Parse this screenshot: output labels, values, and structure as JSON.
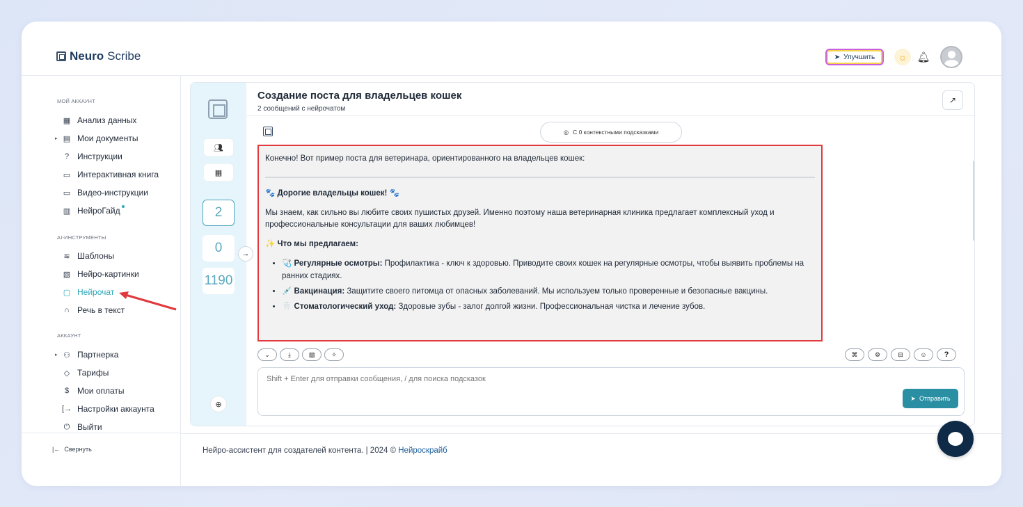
{
  "header": {
    "logo_bold": "Neuro",
    "logo_rest": "Scribe",
    "upgrade_label": "Улучшить",
    "upgrade_icon": "rocket-icon",
    "theme_icon": "sun-icon",
    "notify_icon": "bell-icon"
  },
  "sidebar": {
    "sections": [
      {
        "title": "Мой аккаунт",
        "items": [
          {
            "label": "Анализ данных",
            "icon": "grid-icon",
            "caret": false
          },
          {
            "label": "Мои документы",
            "icon": "document-icon",
            "caret": true
          },
          {
            "label": "Инструкции",
            "icon": "help-icon",
            "caret": false
          },
          {
            "label": "Интерактивная книга",
            "icon": "book-icon",
            "caret": false
          },
          {
            "label": "Видео-инструкции",
            "icon": "video-icon",
            "caret": false
          },
          {
            "label": "НейроГайд",
            "icon": "table-icon",
            "caret": false
          }
        ]
      },
      {
        "title": "AI-инструменты",
        "items": [
          {
            "label": "Шаблоны",
            "icon": "layers-icon"
          },
          {
            "label": "Нейро-картинки",
            "icon": "image-icon"
          },
          {
            "label": "Нейрочат",
            "icon": "chat-icon",
            "active": true
          },
          {
            "label": "Речь в текст",
            "icon": "headphones-icon"
          }
        ]
      },
      {
        "title": "Аккаунт",
        "items": [
          {
            "label": "Партнерка",
            "icon": "users-icon",
            "caret": true
          },
          {
            "label": "Тарифы",
            "icon": "tag-icon"
          },
          {
            "label": "Мои оплаты",
            "icon": "dollar-icon"
          },
          {
            "label": "Настройки аккаунта",
            "icon": "settings-icon"
          },
          {
            "label": "Выйти",
            "icon": "power-icon"
          }
        ]
      }
    ],
    "collapse_label": "Свернуть"
  },
  "chat": {
    "title": "Создание поста для владельцев кошек",
    "subtitle": "2 сообщений с нейрочатом",
    "rail_counts": [
      "2",
      "0",
      "1190"
    ],
    "hint_label": "С 0 контекстными подсказками",
    "message": {
      "intro": "Конечно! Вот пример поста для ветеринара, ориентированного на владельцев кошек:",
      "heading": "Дорогие владельцы кошек!",
      "heading_emoji": "🐾",
      "paragraph": "Мы знаем, как сильно вы любите своих пушистых друзей. Именно поэтому наша ветеринарная клиника предлагает комплексный уход и профессиональные консультации для ваших любимцев!",
      "offer_heading": "Что мы предлагаем:",
      "offer_emoji": "✨",
      "items": [
        {
          "emoji": "🩺",
          "bold": "Регулярные осмотры:",
          "text": " Профилактика - ключ к здоровью. Приводите своих кошек на регулярные осмотры, чтобы выявить проблемы на ранних стадиях."
        },
        {
          "emoji": "💉",
          "bold": "Вакцинация:",
          "text": " Защитите своего питомца от опасных заболеваний. Мы используем только проверенные и безопасные вакцины."
        },
        {
          "emoji": "🦷",
          "bold": "Стоматологический уход:",
          "text": " Здоровые зубы - залог долгой жизни. Профессиональная чистка и лечение зубов."
        }
      ]
    },
    "input_placeholder": "Shift + Enter для отправки сообщения, / для поиска подсказок",
    "send_label": "Отправить"
  },
  "footer": {
    "text": "Нейро-ассистент для создателей контента.  | 2024 © ",
    "link": "Нейроскрайб"
  },
  "colors": {
    "accent": "#2ea8b8",
    "send": "#2a8fa3",
    "highlight": "#e0393e",
    "fab": "#0f2a47"
  }
}
